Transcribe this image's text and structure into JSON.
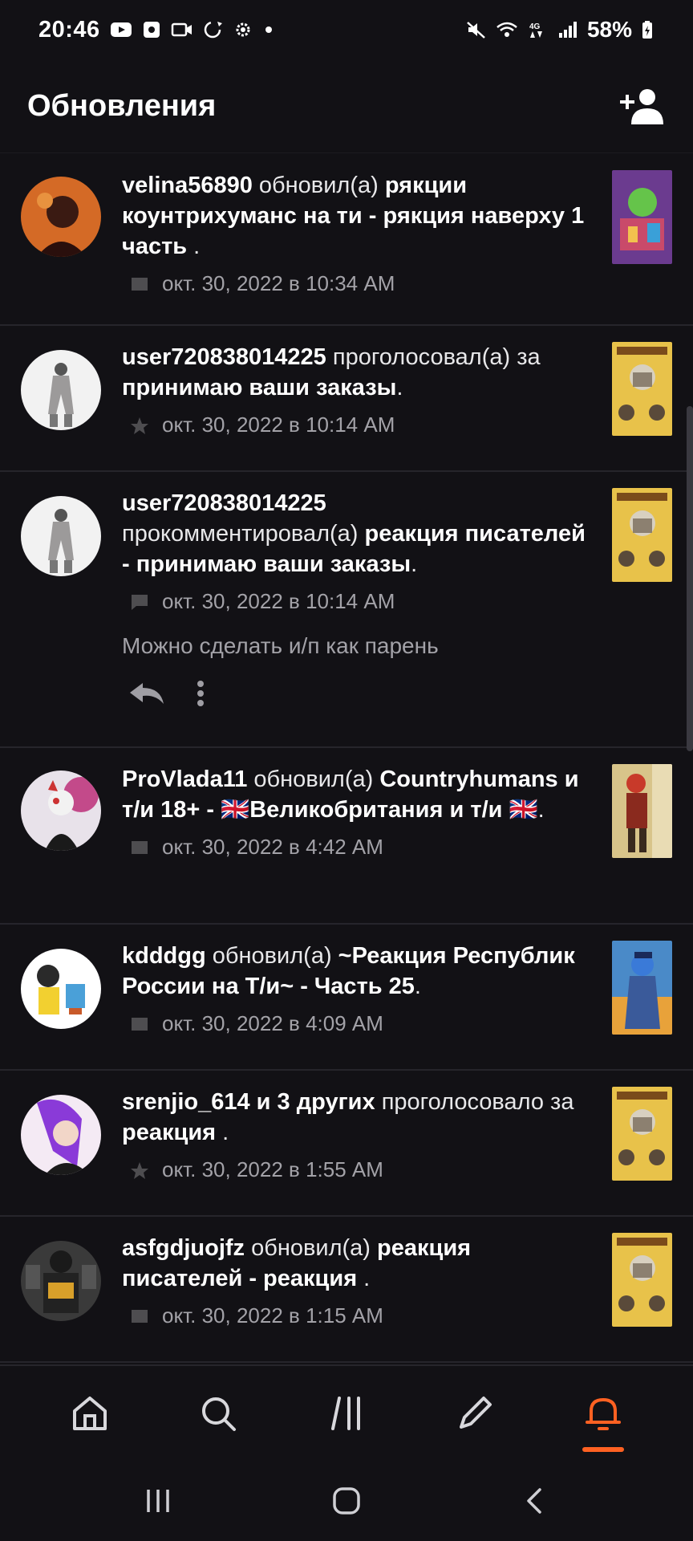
{
  "status_bar": {
    "time": "20:46",
    "battery": "58%",
    "left_icons": [
      "youtube-icon",
      "camera-app-icon",
      "video-icon",
      "sync-icon",
      "settings-icon"
    ],
    "right_icons": [
      "mute-icon",
      "wifi-icon",
      "network-4g-icon",
      "signal-icon",
      "battery-icon"
    ]
  },
  "header": {
    "title": "Обновления"
  },
  "feed": [
    {
      "user": "velina56890",
      "action": " обновил(а) ",
      "target": "рякции коунтрихуманс на ти - рякция наверху 1 часть",
      "suffix": " .",
      "time": "окт. 30, 2022 в 10:34 AM",
      "meta_icon": "book-icon"
    },
    {
      "user": "user720838014225",
      "action": " проголосовал(а) за ",
      "target": "принимаю ваши заказы",
      "suffix": ".",
      "time": "окт. 30, 2022 в 10:14 AM",
      "meta_icon": "star-icon"
    },
    {
      "user": "user720838014225",
      "action": " прокомментировал(а) ",
      "target": "реакция писателей - принимаю ваши заказы",
      "suffix": ".",
      "time": "окт. 30, 2022 в 10:14 AM",
      "meta_icon": "comment-icon",
      "comment": "Можно сделать и/п как парень"
    },
    {
      "user": "ProVlada11",
      "action": " обновил(а) ",
      "target": "Countryhumans и т/и 18+ - 🇬🇧Великобритания и т/и 🇬🇧",
      "suffix": ".",
      "time": "окт. 30, 2022 в 4:42 AM",
      "meta_icon": "book-icon"
    },
    {
      "user": "kdddgg",
      "action": " обновил(а) ",
      "target": "~Реакция Республик России на Т/и~ - Часть 25",
      "suffix": ".",
      "time": "окт. 30, 2022 в 4:09 AM",
      "meta_icon": "book-icon"
    },
    {
      "user": "srenjio_614 и 3 других",
      "action": " проголосовало за ",
      "target": "реакция",
      "suffix": " .",
      "time": "окт. 30, 2022 в 1:55 AM",
      "meta_icon": "star-icon"
    },
    {
      "user": "asfgdjuojfz",
      "action": " обновил(а) ",
      "target": "реакция писателей - реакция",
      "suffix": " .",
      "time": "окт. 30, 2022 в 1:15 AM",
      "meta_icon": "book-icon"
    }
  ],
  "bottom_nav": [
    "home-icon",
    "search-icon",
    "library-icon",
    "write-icon",
    "notifications-icon"
  ],
  "system_nav": [
    "recent-apps-icon",
    "home-circle-icon",
    "back-icon"
  ],
  "colors": {
    "background": "#121115",
    "accent": "#ff6122",
    "muted_text": "#a3a2a8",
    "divider": "#26252b"
  }
}
